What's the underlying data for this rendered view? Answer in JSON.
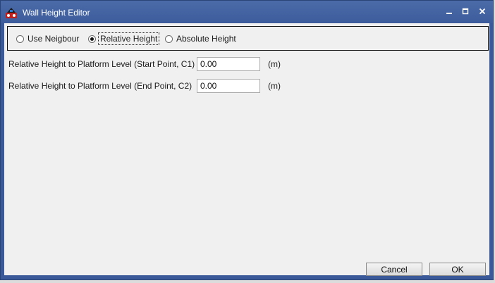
{
  "window": {
    "title": "Wall Height Editor",
    "app_icon": "app-logo-icon"
  },
  "height_mode": {
    "options": [
      {
        "label": "Use Neigbour",
        "selected": false
      },
      {
        "label": "Relative Height",
        "selected": true
      },
      {
        "label": "Absolute Height",
        "selected": false
      }
    ]
  },
  "fields": [
    {
      "label": "Relative Height to Platform Level (Start Point, C1)",
      "value": "0.00",
      "unit": "(m)"
    },
    {
      "label": "Relative Height to Platform Level (End Point, C2)",
      "value": "0.00",
      "unit": "(m)"
    }
  ],
  "buttons": {
    "cancel": "Cancel",
    "ok": "OK"
  },
  "colors": {
    "titlebar": "#3d5c9b",
    "client": "#f0f0f0"
  }
}
